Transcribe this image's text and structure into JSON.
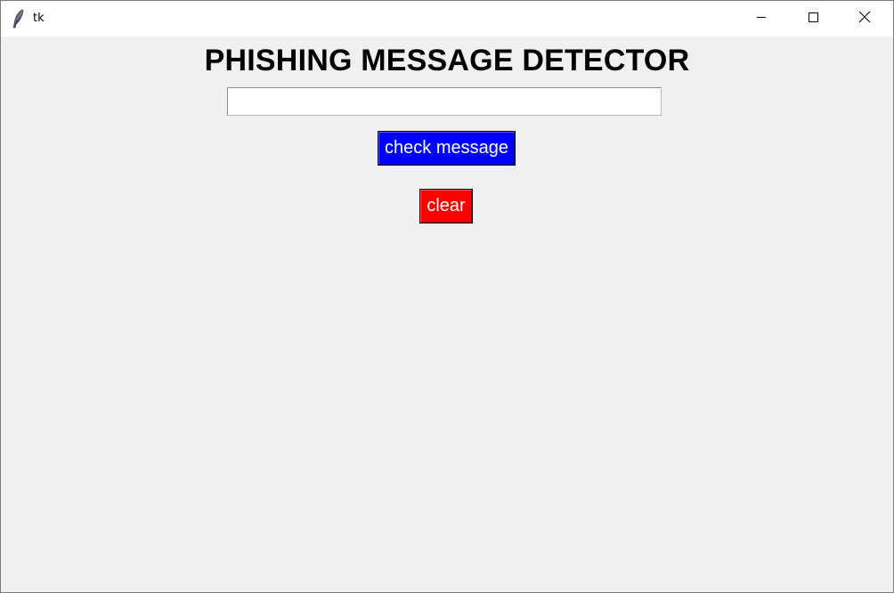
{
  "window": {
    "title": "tk",
    "icon": "feather-icon"
  },
  "titlebar_controls": {
    "minimize_icon": "minimize-icon",
    "maximize_icon": "maximize-icon",
    "close_icon": "close-icon"
  },
  "main": {
    "heading": "PHISHING MESSAGE DETECTOR",
    "message_input": {
      "value": "",
      "placeholder": ""
    },
    "check_button_label": "check message",
    "clear_button_label": "clear"
  },
  "colors": {
    "background": "#f0f0f0",
    "check_button": "#0000ff",
    "clear_button": "#ff0000",
    "button_text": "#ffffff"
  }
}
